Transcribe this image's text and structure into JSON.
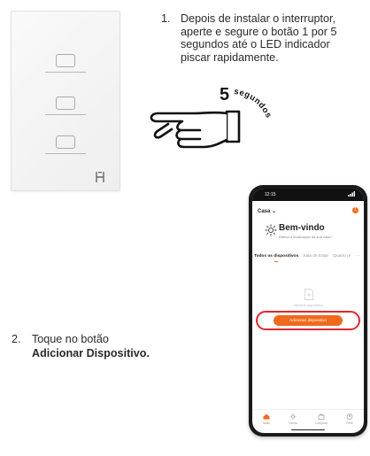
{
  "step1": {
    "number": "1.",
    "line1": "Depois de instalar o interruptor,",
    "line2": "aperte e segure o botão 1 por 5",
    "line3": "segundos até o LED indicador",
    "line4": "piscar rapidamente."
  },
  "timer": {
    "value": "5",
    "unit": "segundos"
  },
  "step2": {
    "number": "2.",
    "text": "Toque no botão",
    "bold": "Adicionar Dispositivo."
  },
  "phone": {
    "time": "12:15",
    "home_label": "Casa ⌄",
    "notification_count": "1",
    "welcome_title": "Bem-vindo",
    "welcome_subtitle": "Defina a localização da sua casa ›",
    "tabs": [
      "Todos os dispositivos",
      "Sala de Estar",
      "Quarto pr",
      "···"
    ],
    "empty_text": "Adicione dispositivos...",
    "add_button_label": "Adicionar dispositivo",
    "tabbar": [
      "Início",
      "Cenas",
      "Compras",
      "Perfil"
    ],
    "accent_color": "#f06a1d",
    "highlight_color": "#e0282e"
  }
}
